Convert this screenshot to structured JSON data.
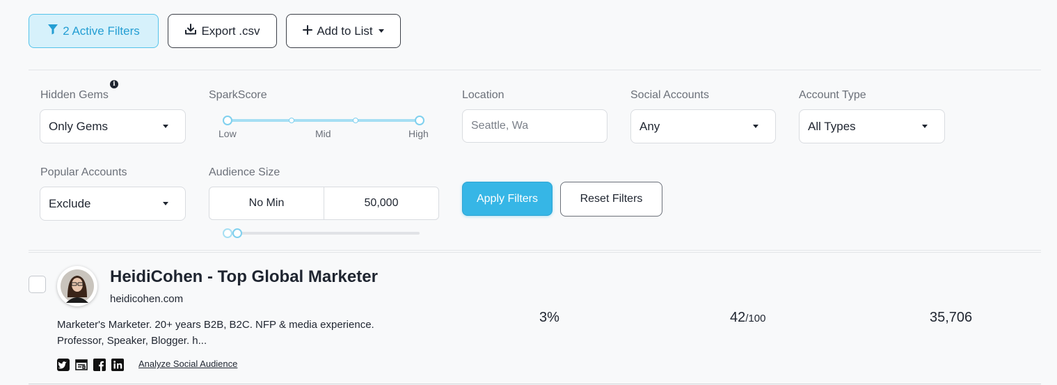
{
  "toolbar": {
    "active_filters_label": "2 Active Filters",
    "export_label": "Export .csv",
    "add_to_list_label": "Add to List"
  },
  "filters": {
    "hidden_gems": {
      "label": "Hidden Gems",
      "value": "Only Gems"
    },
    "spark_score": {
      "label": "SparkScore",
      "low": "Low",
      "mid": "Mid",
      "high": "High"
    },
    "location": {
      "label": "Location",
      "placeholder": "Seattle, Wa"
    },
    "social_accounts": {
      "label": "Social Accounts",
      "value": "Any"
    },
    "account_type": {
      "label": "Account Type",
      "value": "All Types"
    },
    "popular_accounts": {
      "label": "Popular Accounts",
      "value": "Exclude"
    },
    "audience_size": {
      "label": "Audience Size",
      "min": "No Min",
      "max": "50,000"
    },
    "apply_label": "Apply Filters",
    "reset_label": "Reset Filters"
  },
  "results": [
    {
      "name": "HeidiCohen - Top Global Marketer",
      "domain": "heidicohen.com",
      "bio": "Marketer's Marketer. 20+ years B2B, B2C. NFP & media experience. Professor, Speaker, Blogger. h...",
      "engagement": "3%",
      "spark_score": "42",
      "spark_score_max": "/100",
      "audience": "35,706",
      "analyze_label": "Analyze Social Audience",
      "social_icons": [
        "twitter-icon",
        "blog-icon",
        "facebook-icon",
        "linkedin-icon"
      ]
    }
  ],
  "colors": {
    "accent": "#36b6e6",
    "accent_light": "#d6f1fb",
    "text": "#1f2530",
    "muted": "#6b7079"
  }
}
